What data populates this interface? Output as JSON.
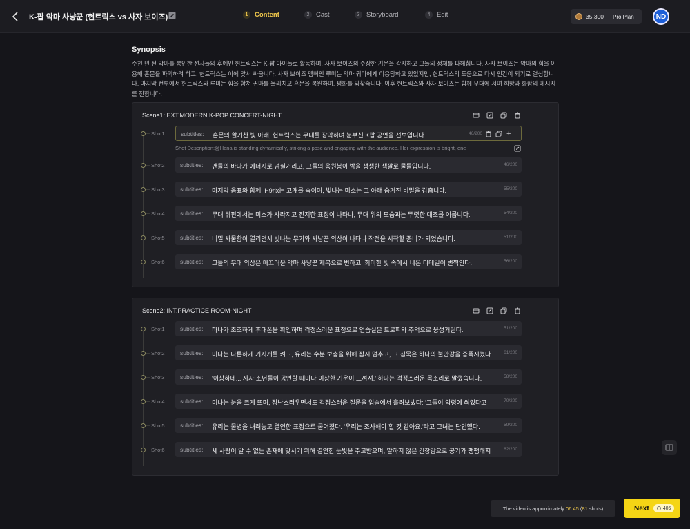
{
  "header": {
    "title": "K-팝 악마 사냥꾼 (헌트릭스 vs 사자 보이즈)",
    "steps": [
      {
        "num": "1",
        "label": "Content"
      },
      {
        "num": "2",
        "label": "Cast"
      },
      {
        "num": "3",
        "label": "Storyboard"
      },
      {
        "num": "4",
        "label": "Edit"
      }
    ],
    "active_step": "Content",
    "credits": "35,300",
    "plan": "Pro Plan",
    "avatar": "ND"
  },
  "synopsis": {
    "title": "Synopsis",
    "text": "수천 년 전 악마를 봉인한 선사들의 후예인 헌트릭스는 K-팝 아이돌로 활동하며, 사자 보이즈의 수상한 기운을 감지하고 그들의 정체를 파헤칩니다. 사자 보이즈는 악마의 힘을 이용해 혼문을 파괴하려 하고, 헌트릭스는 이에 맞서 싸웁니다. 사자 보이즈 멤버인 루미는 악마 귀마에게 이용당하고 있었지만, 헌트릭스의 도움으로 다시 인간이 되기로 결심합니다. 마지막 전투에서 헌트릭스와 루미는 힘을 합쳐 귀마를 물리치고 혼문을 복원하며, 평화를 되찾습니다. 이후 헌트릭스와 사자 보이즈는 함께 무대에 서며 희망과 화합의 메시지를 전합니다."
  },
  "subtitles_label": "subtitles:",
  "scenes": [
    {
      "title": "Scene1: EXT.MODERN K-POP CONCERT-NIGHT",
      "shots": [
        {
          "label": "Shot1",
          "text": "혼문의 활기찬 빛 아래, 헌트릭스는 무대를 장악하며 눈부신 K팝 공연을 선보입니다.",
          "count": "46/200"
        },
        {
          "label": "Shot2",
          "text": "팬들의 바다가 에너지로 넘실거리고, 그들의 응원봉이 밤을 생생한 색깔로 물들입니다.",
          "count": "46/200"
        },
        {
          "label": "Shot3",
          "text": "마지막 음표와 함께, H9rix는 고개를 숙이며, 빛나는 미소는 그 아래 숨겨진 비밀을 감춥니다.",
          "count": "55/200"
        },
        {
          "label": "Shot4",
          "text": "무대 뒤편에서는 미소가 사라지고 진지한 표정이 나타나, 무대 위의 모습과는 뚜렷한 대조를 이룹니다.",
          "count": "54/200"
        },
        {
          "label": "Shot5",
          "text": "비밀 사물함이 열리면서 빛나는 무기와 사냥꾼 의상이 나타나 작전을 시작할 준비가 되었습니다.",
          "count": "51/200"
        },
        {
          "label": "Shot6",
          "text": "그들의 무대 의상은 매끄러운 악마 사냥꾼 제복으로 변하고, 희미한 빛 속에서 네온 디테일이 번쩍인다.",
          "count": "56/200"
        }
      ],
      "shot_description": "Shot Description:@Hana is standing dynamically, striking a pose and engaging with the audience. Her expression is bright, ene"
    },
    {
      "title": "Scene2: INT.PRACTICE ROOM-NIGHT",
      "shots": [
        {
          "label": "Shot1",
          "text": "하나가 초조하게 휴대폰을 확인하며 걱정스러운 표정으로 연습실은 트로피와 추억으로 웅성거린다.",
          "count": "51/200"
        },
        {
          "label": "Shot2",
          "text": "미나는 나른하게 기지개를 켜고, 유리는 수분 보충을 위해 잠시 멈추고, 그 침묵은 하나의 불안감을 증폭시켰다.",
          "count": "61/200"
        },
        {
          "label": "Shot3",
          "text": "'이상하네... 사자 소년들이 공연할 때마다 이상한 기운이 느껴져.' 하나는 걱정스러운 목소리로 말했습니다.",
          "count": "58/200"
        },
        {
          "label": "Shot4",
          "text": "미나는 눈을 크게 뜨며, 장난스러우면서도 걱정스러운 질문을 입술에서 흘려보냈다: '그들이 악령에 씌었다고",
          "count": "70/200"
        },
        {
          "label": "Shot5",
          "text": "유리는 물병을 내려놓고 결연한 표정으로 굳어졌다. '우리는 조사해야 할 것 같아요.'라고 그녀는 단언했다.",
          "count": "59/200"
        },
        {
          "label": "Shot6",
          "text": "세 사람이 알 수 없는 존재에 맞서기 위해 결연한 눈빛을 주고받으며, 말하지 않은 긴장감으로 공기가 팽팽해지",
          "count": "62/200"
        }
      ]
    }
  ],
  "footer": {
    "status_prefix": "The video is approximately",
    "duration": "06:45",
    "shots_count": "81",
    "status_suffix_open": "(",
    "status_suffix_close": "shots)",
    "next_label": "Next",
    "next_cost": "405"
  },
  "colors": {
    "accent": "#f5d515",
    "avatar": "#1e5fd8"
  }
}
